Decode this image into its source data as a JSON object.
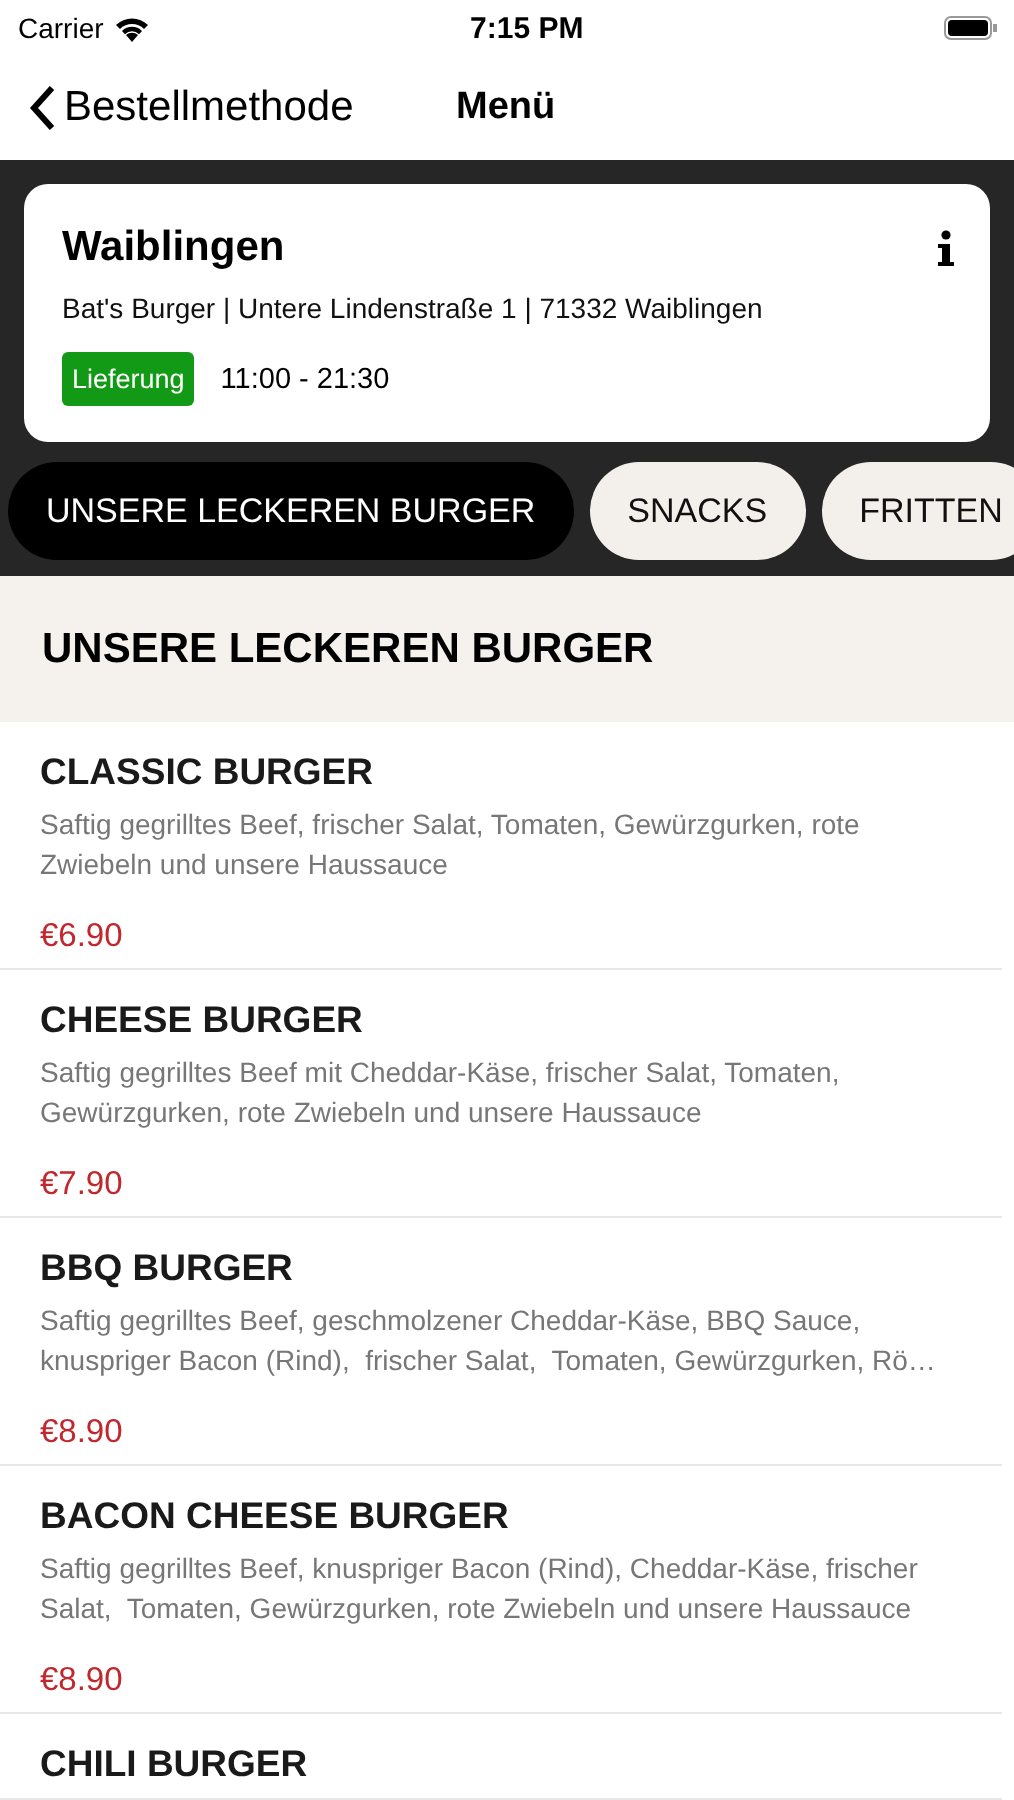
{
  "status_bar": {
    "carrier": "Carrier",
    "time": "7:15 PM"
  },
  "nav": {
    "back": "Bestellmethode",
    "title": "Menü"
  },
  "store": {
    "name": "Waiblingen",
    "address": "Bat's Burger | Untere Lindenstraße 1 | 71332 Waiblingen",
    "badge": "Lieferung",
    "hours": "11:00 - 21:30"
  },
  "categories": [
    {
      "label": "UNSERE LECKEREN BURGER",
      "selected": true
    },
    {
      "label": "SNACKS",
      "selected": false
    },
    {
      "label": "FRITTEN",
      "selected": false
    }
  ],
  "section": {
    "title": "UNSERE LECKEREN BURGER"
  },
  "items": [
    {
      "name": "CLASSIC BURGER",
      "description": "Saftig gegrilltes Beef, frischer Salat, Tomaten, Gewürzgurken, rote Zwiebeln und unsere Haussauce",
      "price": "€6.90"
    },
    {
      "name": "CHEESE BURGER",
      "description": "Saftig gegrilltes Beef mit Cheddar-Käse, frischer Salat, Tomaten, Gewürzgurken, rote Zwiebeln und unsere Haussauce",
      "price": "€7.90"
    },
    {
      "name": "BBQ BURGER",
      "description": "Saftig gegrilltes Beef, geschmolzener Cheddar-Käse, BBQ Sauce, knuspriger Bacon (Rind),  frischer Salat,  Tomaten, Gewürzgurken, Rö…",
      "price": "€8.90"
    },
    {
      "name": "BACON CHEESE BURGER",
      "description": "Saftig gegrilltes Beef, knuspriger Bacon (Rind), Cheddar-Käse, frischer Salat,  Tomaten, Gewürzgurken, rote Zwiebeln und unsere Haussauce",
      "price": "€8.90"
    },
    {
      "name": "CHILI BURGER"
    }
  ]
}
